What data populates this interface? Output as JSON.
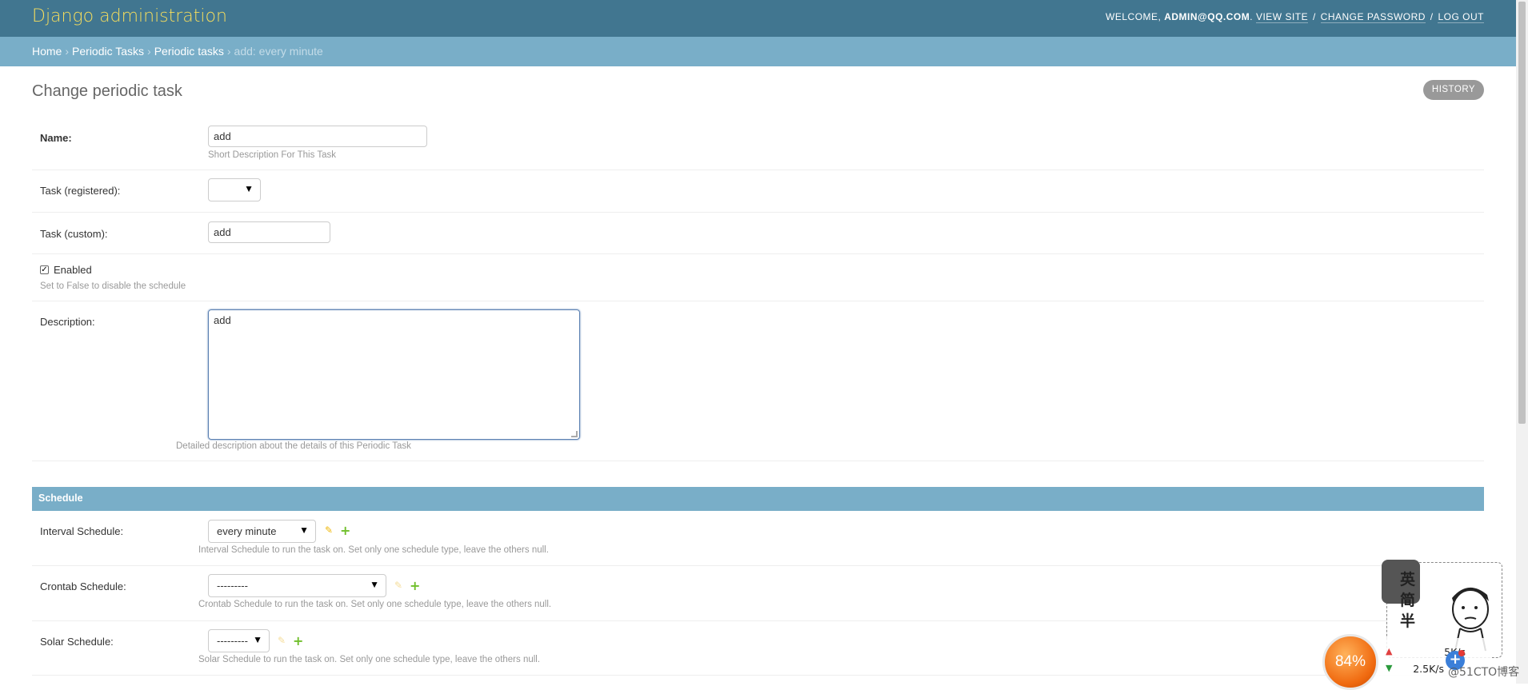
{
  "header": {
    "branding": "Django administration",
    "welcome": "WELCOME, ",
    "user": "ADMIN@QQ.COM",
    "user_suffix": ".",
    "view_site": "VIEW SITE",
    "change_password": "CHANGE PASSWORD",
    "log_out": "LOG OUT",
    "separator": "/"
  },
  "breadcrumbs": {
    "items": [
      "Home",
      "Periodic Tasks",
      "Periodic tasks"
    ],
    "current": "add: every minute",
    "separator": "›"
  },
  "page": {
    "title": "Change periodic task",
    "history_label": "HISTORY"
  },
  "form": {
    "name": {
      "label": "Name:",
      "value": "add",
      "help": "Short Description For This Task"
    },
    "task_registered": {
      "label": "Task (registered):",
      "value": ""
    },
    "task_custom": {
      "label": "Task (custom):",
      "value": "add"
    },
    "enabled": {
      "label": "Enabled",
      "checked": true,
      "help": "Set to False to disable the schedule"
    },
    "description": {
      "label": "Description:",
      "value": "add",
      "help": "Detailed description about the details of this Periodic Task"
    }
  },
  "schedule": {
    "header": "Schedule",
    "interval": {
      "label": "Interval Schedule:",
      "value": "every minute",
      "help": "Interval Schedule to run the task on. Set only one schedule type, leave the others null."
    },
    "crontab": {
      "label": "Crontab Schedule:",
      "value": "---------",
      "help": "Crontab Schedule to run the task on. Set only one schedule type, leave the others null."
    },
    "solar": {
      "label": "Solar Schedule:",
      "value": "---------",
      "help": "Solar Schedule to run the task on. Set only one schedule type, leave the others null."
    }
  },
  "overlay": {
    "sticker_text": "英简半",
    "speed_percent": "84%",
    "upload_speed": "5K/s",
    "download_speed": "2.5K/s",
    "watermark": "@51CTO博客",
    "plus": "+"
  },
  "icons": {
    "edit": "pencil-icon",
    "add": "plus-icon",
    "dropdown": "triangle-down-icon",
    "check": "checkmark-icon"
  },
  "colors": {
    "header_bg": "#417690",
    "breadcrumb_bg": "#79aec8",
    "brand": "#f5dd5d",
    "add_green": "#70bf2b",
    "edit_yellow": "#efb80b"
  }
}
